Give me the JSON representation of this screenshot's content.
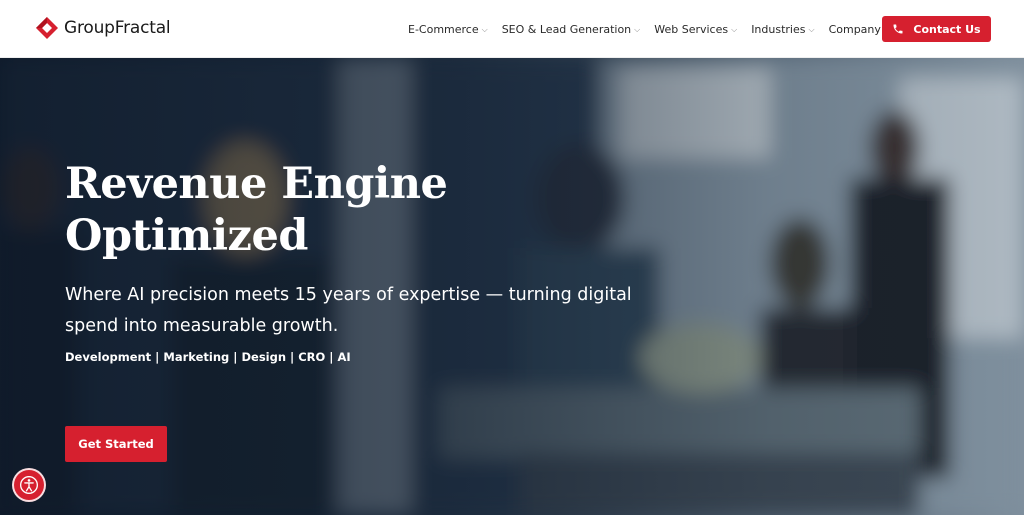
{
  "brand": {
    "name": "GroupFractal",
    "accent_color": "#d6202f"
  },
  "nav": {
    "items": [
      {
        "label": "E-Commerce"
      },
      {
        "label": "SEO & Lead Generation"
      },
      {
        "label": "Web Services"
      },
      {
        "label": "Industries"
      },
      {
        "label": "Company"
      }
    ],
    "contact_label": "Contact Us",
    "contact_icon": "phone-icon"
  },
  "hero": {
    "title_line1": "Revenue Engine",
    "title_line2": "Optimized",
    "subtitle": "Where AI precision meets 15 years of expertise — turning digital spend into measurable growth.",
    "tags": "Development | Marketing | Design | CRO | AI",
    "cta_label": "Get Started"
  },
  "widgets": {
    "accessibility_icon": "accessibility-icon"
  }
}
